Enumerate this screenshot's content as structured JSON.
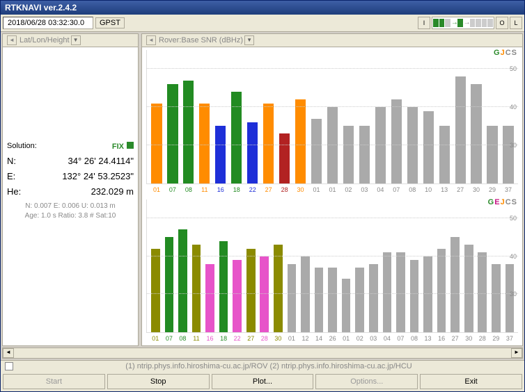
{
  "title": "RTKNAVI ver.2.4.2",
  "datetime": "2018/06/28 03:32:30.0",
  "gpst_label": "GPST",
  "indicators": {
    "i": "I",
    "o": "O",
    "l": "L"
  },
  "left_header": "Lat/Lon/Height",
  "right_header": "Rover:Base SNR (dBHz)",
  "solution_label": "Solution:",
  "solution_value": "FIX",
  "coords": {
    "n_lbl": "N:",
    "n_val": "34° 26' 24.4114\"",
    "e_lbl": "E:",
    "e_val": "132° 24' 53.2523\"",
    "h_lbl": "He:",
    "h_val": "232.029 m"
  },
  "stats1": "N: 0.007 E: 0.006 U: 0.013 m",
  "stats2": "Age: 1.0 s Ratio: 3.8 # Sat:10",
  "status_text": "(1) ntrip.phys.info.hiroshima-cu.ac.jp/ROV (2) ntrip.phys.info.hiroshima-cu.ac.jp/HCU",
  "buttons": {
    "start": "Start",
    "stop": "Stop",
    "plot": "Plot...",
    "options": "Options...",
    "exit": "Exit"
  },
  "chart_data": [
    {
      "type": "bar",
      "title": "Rover SNR",
      "ylabel": "dBHz",
      "ylim": [
        20,
        55
      ],
      "legend": [
        "G",
        "J",
        "C",
        "S"
      ],
      "yticks": [
        30,
        40,
        50
      ],
      "series": [
        {
          "sat": "01",
          "v": 41,
          "c": "orange"
        },
        {
          "sat": "07",
          "v": 46,
          "c": "green"
        },
        {
          "sat": "08",
          "v": 47,
          "c": "green"
        },
        {
          "sat": "11",
          "v": 41,
          "c": "orange"
        },
        {
          "sat": "16",
          "v": 35,
          "c": "blue"
        },
        {
          "sat": "18",
          "v": 44,
          "c": "green"
        },
        {
          "sat": "22",
          "v": 36,
          "c": "blue"
        },
        {
          "sat": "27",
          "v": 41,
          "c": "orange"
        },
        {
          "sat": "28",
          "v": 33,
          "c": "red"
        },
        {
          "sat": "30",
          "v": 42,
          "c": "orange"
        },
        {
          "sat": "01",
          "v": 37,
          "c": "gray"
        },
        {
          "sat": "01",
          "v": 40,
          "c": "gray"
        },
        {
          "sat": "02",
          "v": 35,
          "c": "gray"
        },
        {
          "sat": "03",
          "v": 35,
          "c": "gray"
        },
        {
          "sat": "04",
          "v": 40,
          "c": "gray"
        },
        {
          "sat": "07",
          "v": 42,
          "c": "gray"
        },
        {
          "sat": "08",
          "v": 40,
          "c": "gray"
        },
        {
          "sat": "10",
          "v": 39,
          "c": "gray"
        },
        {
          "sat": "13",
          "v": 35,
          "c": "gray"
        },
        {
          "sat": "27",
          "v": 48,
          "c": "gray"
        },
        {
          "sat": "30",
          "v": 46,
          "c": "gray"
        },
        {
          "sat": "29",
          "v": 35,
          "c": "gray"
        },
        {
          "sat": "37",
          "v": 35,
          "c": "gray"
        }
      ]
    },
    {
      "type": "bar",
      "title": "Base SNR",
      "ylabel": "dBHz",
      "ylim": [
        20,
        55
      ],
      "legend": [
        "G",
        "E",
        "J",
        "C",
        "S"
      ],
      "yticks": [
        30,
        40,
        50
      ],
      "series": [
        {
          "sat": "01",
          "v": 42,
          "c": "olive"
        },
        {
          "sat": "07",
          "v": 45,
          "c": "green"
        },
        {
          "sat": "08",
          "v": 47,
          "c": "green"
        },
        {
          "sat": "11",
          "v": 43,
          "c": "olive"
        },
        {
          "sat": "16",
          "v": 38,
          "c": "magenta"
        },
        {
          "sat": "18",
          "v": 44,
          "c": "green"
        },
        {
          "sat": "22",
          "v": 39,
          "c": "magenta"
        },
        {
          "sat": "27",
          "v": 42,
          "c": "olive"
        },
        {
          "sat": "28",
          "v": 40,
          "c": "magenta"
        },
        {
          "sat": "30",
          "v": 43,
          "c": "olive"
        },
        {
          "sat": "01",
          "v": 38,
          "c": "gray"
        },
        {
          "sat": "12",
          "v": 40,
          "c": "gray"
        },
        {
          "sat": "14",
          "v": 37,
          "c": "gray"
        },
        {
          "sat": "26",
          "v": 37,
          "c": "gray"
        },
        {
          "sat": "01",
          "v": 34,
          "c": "gray"
        },
        {
          "sat": "02",
          "v": 37,
          "c": "gray"
        },
        {
          "sat": "03",
          "v": 38,
          "c": "gray"
        },
        {
          "sat": "04",
          "v": 41,
          "c": "gray"
        },
        {
          "sat": "07",
          "v": 41,
          "c": "gray"
        },
        {
          "sat": "08",
          "v": 39,
          "c": "gray"
        },
        {
          "sat": "13",
          "v": 40,
          "c": "gray"
        },
        {
          "sat": "16",
          "v": 42,
          "c": "gray"
        },
        {
          "sat": "27",
          "v": 45,
          "c": "gray"
        },
        {
          "sat": "30",
          "v": 43,
          "c": "gray"
        },
        {
          "sat": "28",
          "v": 41,
          "c": "gray"
        },
        {
          "sat": "29",
          "v": 38,
          "c": "gray"
        },
        {
          "sat": "37",
          "v": 38,
          "c": "gray"
        }
      ]
    }
  ]
}
